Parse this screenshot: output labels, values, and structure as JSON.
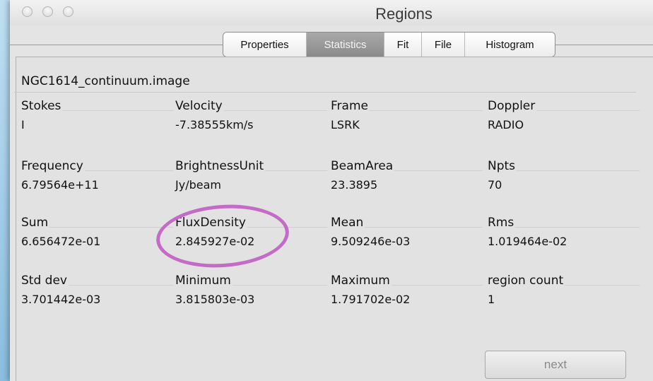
{
  "window": {
    "title": "Regions"
  },
  "tabs": [
    {
      "label": "Properties",
      "active": false
    },
    {
      "label": "Statistics",
      "active": true
    },
    {
      "label": "Fit",
      "active": false
    },
    {
      "label": "File",
      "active": false
    },
    {
      "label": "Histogram",
      "active": false
    }
  ],
  "image_name": "NGC1614_continuum.image",
  "stats": [
    [
      {
        "label": "Stokes",
        "value": "I"
      },
      {
        "label": "Velocity",
        "value": "-7.38555km/s"
      },
      {
        "label": "Frame",
        "value": "LSRK"
      },
      {
        "label": "Doppler",
        "value": "RADIO"
      }
    ],
    [
      {
        "label": "Frequency",
        "value": "6.79564e+11"
      },
      {
        "label": "BrightnessUnit",
        "value": "Jy/beam"
      },
      {
        "label": "BeamArea",
        "value": "23.3895"
      },
      {
        "label": "Npts",
        "value": "70"
      }
    ],
    [
      {
        "label": "Sum",
        "value": "6.656472e-01"
      },
      {
        "label": "FluxDensity",
        "value": "2.845927e-02"
      },
      {
        "label": "Mean",
        "value": "9.509246e-03"
      },
      {
        "label": "Rms",
        "value": "1.019464e-02"
      }
    ],
    [
      {
        "label": "Std dev",
        "value": "3.701442e-03"
      },
      {
        "label": "Minimum",
        "value": "3.815803e-03"
      },
      {
        "label": "Maximum",
        "value": "1.791702e-02"
      },
      {
        "label": "region count",
        "value": "1"
      }
    ]
  ],
  "next_label": "next",
  "colors": {
    "highlight": "#c46bc7",
    "active_tab": "#999999",
    "desktop": "#3f86bd"
  }
}
